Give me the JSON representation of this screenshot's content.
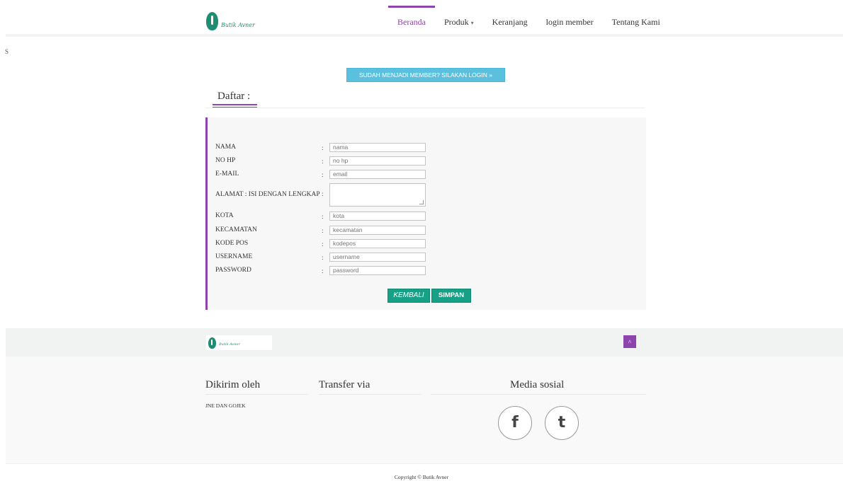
{
  "brand": {
    "logo_text": "Butik Avner",
    "icon": "butik-logo-icon"
  },
  "nav": {
    "items": [
      {
        "label": "Beranda",
        "active": true
      },
      {
        "label": "Produk",
        "dropdown": true
      },
      {
        "label": "Keranjang"
      },
      {
        "label": "login member"
      },
      {
        "label": "Tentang Kami"
      }
    ]
  },
  "stray_text": "S",
  "login_button": "SUDAH MENJADI MEMBER? SILAKAN LOGIN »",
  "form": {
    "title": "Daftar :",
    "fields": [
      {
        "label": "NAMA",
        "placeholder": "nama"
      },
      {
        "label": "NO HP",
        "placeholder": "no hp"
      },
      {
        "label": "E-MAIL",
        "placeholder": "email"
      },
      {
        "label": "ALAMAT : ISI DENGAN LENGKAP",
        "placeholder": ""
      },
      {
        "label": "KOTA",
        "placeholder": "kota"
      },
      {
        "label": "KECAMATAN",
        "placeholder": "kecamatan"
      },
      {
        "label": "KODE POS",
        "placeholder": "kodepos"
      },
      {
        "label": "USERNAME",
        "placeholder": "username"
      },
      {
        "label": "PASSWORD",
        "placeholder": "password"
      }
    ],
    "colon": ":",
    "back_label": "KEMBALI",
    "save_label": "SIMPAN"
  },
  "footer": {
    "shipping_title": "Dikirim oleh",
    "shipping_text": "JNE DAN GOJEK",
    "transfer_title": "Transfer via",
    "social_title": "Media sosial",
    "social": [
      {
        "glyph": "f",
        "icon": "facebook-icon"
      },
      {
        "glyph": "t",
        "icon": "tumblr-icon"
      }
    ],
    "to_top_glyph": "^",
    "copyright": "Copyright © Butik Avner"
  },
  "colors": {
    "accent": "#8e44ad",
    "info": "#5bc0de",
    "success": "#16a085",
    "brand": "#1f8d74"
  }
}
